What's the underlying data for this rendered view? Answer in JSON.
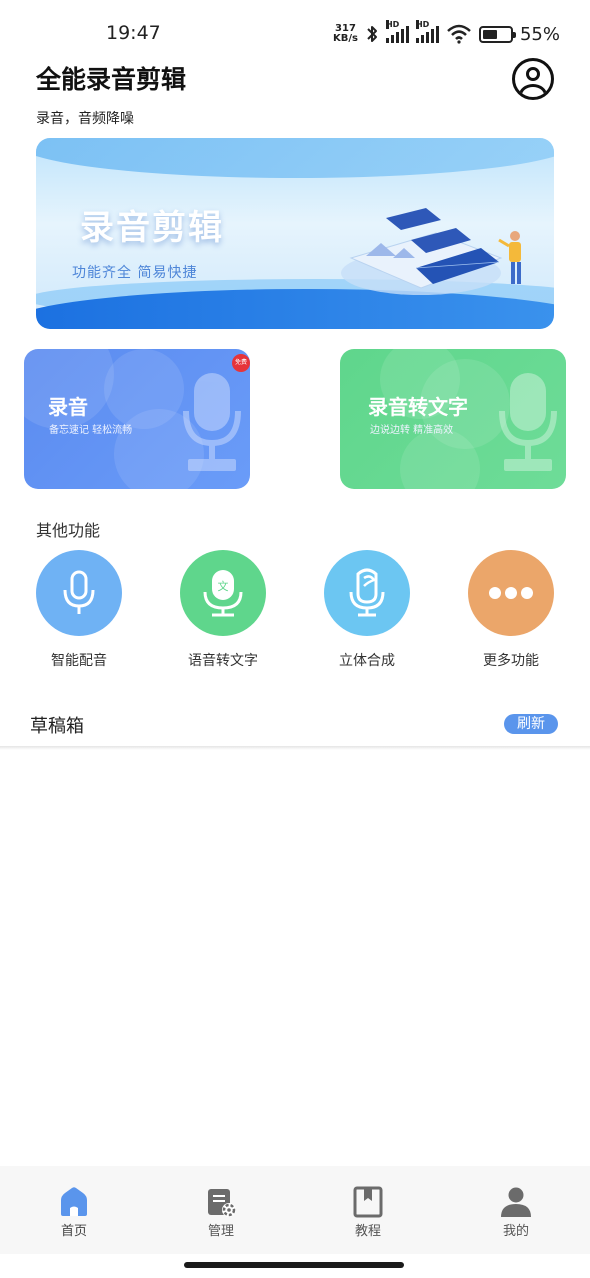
{
  "status_bar": {
    "time": "19:47",
    "net_speed_value": "317",
    "net_speed_unit": "KB/s",
    "hd_label": "HD",
    "battery_percent": "55%",
    "battery_level": 0.55
  },
  "header": {
    "title": "全能录音剪辑",
    "subtitle": "录音，音频降噪"
  },
  "banner": {
    "title": "录音剪辑",
    "subtitle": "功能齐全 简易快捷"
  },
  "cards": {
    "record": {
      "title": "录音",
      "subtitle": "备忘速记 轻松流畅",
      "badge": "免费",
      "color": "#5b8bf0"
    },
    "speech_to_text": {
      "title": "录音转文字",
      "subtitle": "边说边转 精准高效",
      "color": "#5fd68c"
    }
  },
  "other_functions": {
    "label": "其他功能",
    "items": [
      {
        "label": "智能配音",
        "icon": "microphone-icon",
        "color": "#6fb2f4"
      },
      {
        "label": "语音转文字",
        "icon": "mic-text-icon",
        "color": "#5fd68c"
      },
      {
        "label": "立体合成",
        "icon": "stereo-mic-icon",
        "color": "#6cc6f2"
      },
      {
        "label": "更多功能",
        "icon": "more-dots-icon",
        "color": "#eba66a"
      }
    ]
  },
  "drafts": {
    "title": "草稿箱",
    "refresh_label": "刷新"
  },
  "bottom_nav": {
    "items": [
      {
        "label": "首页",
        "icon": "home-icon",
        "active": true
      },
      {
        "label": "管理",
        "icon": "manage-icon",
        "active": false
      },
      {
        "label": "教程",
        "icon": "tutorial-icon",
        "active": false
      },
      {
        "label": "我的",
        "icon": "user-icon",
        "active": false
      }
    ],
    "active_color": "#5a95ec"
  }
}
